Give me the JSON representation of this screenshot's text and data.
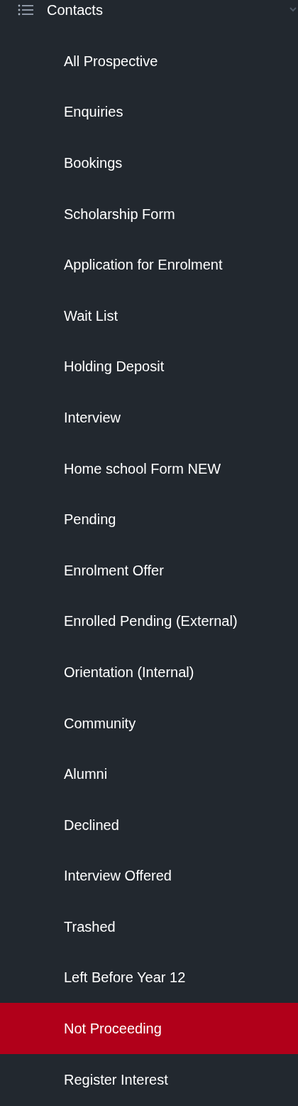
{
  "section": {
    "title": "Contacts",
    "expanded": true
  },
  "items": [
    {
      "label": "All Prospective",
      "selected": false
    },
    {
      "label": "Enquiries",
      "selected": false
    },
    {
      "label": "Bookings",
      "selected": false
    },
    {
      "label": "Scholarship Form",
      "selected": false
    },
    {
      "label": "Application for Enrolment",
      "selected": false
    },
    {
      "label": "Wait List",
      "selected": false
    },
    {
      "label": "Holding Deposit",
      "selected": false
    },
    {
      "label": "Interview",
      "selected": false
    },
    {
      "label": "Home school Form NEW",
      "selected": false
    },
    {
      "label": "Pending",
      "selected": false
    },
    {
      "label": "Enrolment Offer",
      "selected": false
    },
    {
      "label": "Enrolled Pending (External)",
      "selected": false
    },
    {
      "label": "Orientation (Internal)",
      "selected": false
    },
    {
      "label": "Community",
      "selected": false
    },
    {
      "label": "Alumni",
      "selected": false
    },
    {
      "label": "Declined",
      "selected": false
    },
    {
      "label": "Interview Offered",
      "selected": false
    },
    {
      "label": "Trashed",
      "selected": false
    },
    {
      "label": "Left Before Year 12",
      "selected": false
    },
    {
      "label": "Not Proceeding",
      "selected": true
    },
    {
      "label": "Register Interest",
      "selected": false
    }
  ]
}
